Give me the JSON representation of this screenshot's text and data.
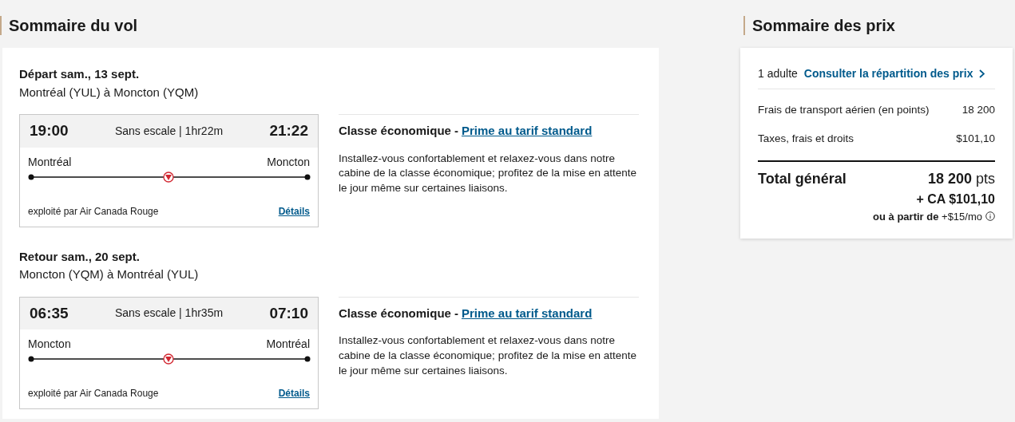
{
  "flight_summary": {
    "title": "Sommaire du vol",
    "bounds": [
      {
        "heading": "Départ sam., 13 sept.",
        "route": "Montréal (YUL) à Moncton (YQM)",
        "depart_time": "19:00",
        "stops": "Sans escale | 1hr22m",
        "arrive_time": "21:22",
        "origin": "Montréal",
        "destination": "Moncton",
        "operator": "exploité par Air Canada Rouge",
        "details_link": "Détails",
        "cabin": "Classe économique -",
        "fare_link": "Prime au tarif standard",
        "description": "Installez-vous confortablement et relaxez-vous dans notre cabine de la classe économique; profitez de la mise en attente le jour même sur certaines liaisons."
      },
      {
        "heading": "Retour sam., 20 sept.",
        "route": "Moncton (YQM) à Montréal (YUL)",
        "depart_time": "06:35",
        "stops": "Sans escale | 1hr35m",
        "arrive_time": "07:10",
        "origin": "Moncton",
        "destination": "Montréal",
        "operator": "exploité par Air Canada Rouge",
        "details_link": "Détails",
        "cabin": "Classe économique -",
        "fare_link": "Prime au tarif standard",
        "description": "Installez-vous confortablement et relaxez-vous dans notre cabine de la classe économique; profitez de la mise en attente le jour même sur certaines liaisons."
      }
    ]
  },
  "price_summary": {
    "title": "Sommaire des prix",
    "passengers": "1 adulte",
    "breakdown_link": "Consulter la répartition des prix",
    "lines": [
      {
        "label": "Frais de transport aérien (en points)",
        "value": "18 200"
      },
      {
        "label": "Taxes, frais et droits",
        "value": "$101,10"
      }
    ],
    "total_label": "Total général",
    "total_points": "**18 200** pts",
    "total_cash": "+ CA $101,10",
    "financing": "**ou à partir de** +$15/mo"
  }
}
